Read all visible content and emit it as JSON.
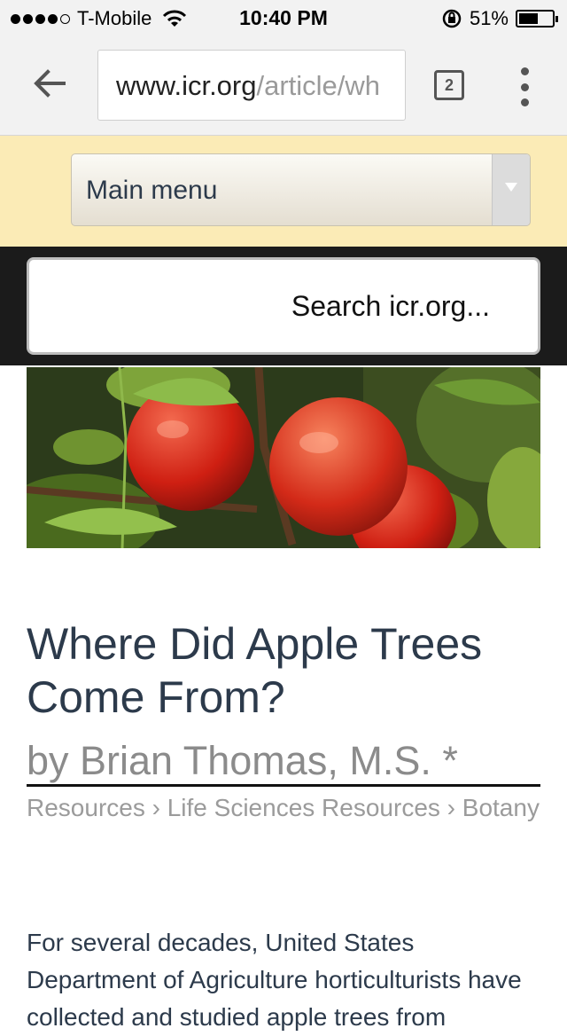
{
  "status_bar": {
    "carrier": "T-Mobile",
    "time": "10:40 PM",
    "battery": "51%",
    "signal_dots_filled": 4,
    "battery_level": 0.51
  },
  "browser": {
    "url_host": "www.icr.org",
    "url_path": "/article/wh",
    "tab_count": "2"
  },
  "menu": {
    "label": "Main menu"
  },
  "search": {
    "placeholder": "Search icr.org..."
  },
  "article": {
    "title": "Where Did Apple Trees Come From?",
    "byline": "by Brian Thomas, M.S. *",
    "breadcrumbs": [
      "Resources",
      "Life Sciences Resources",
      "Botany"
    ],
    "breadcrumb_separator": "›",
    "body": "For several decades, United States Department of Agriculture horticulturists have collected and studied apple trees from"
  },
  "colors": {
    "menu_band": "#fbebb6",
    "search_band": "#1b1b1b",
    "title": "#2c3a4b",
    "muted": "#9b9b9b"
  }
}
